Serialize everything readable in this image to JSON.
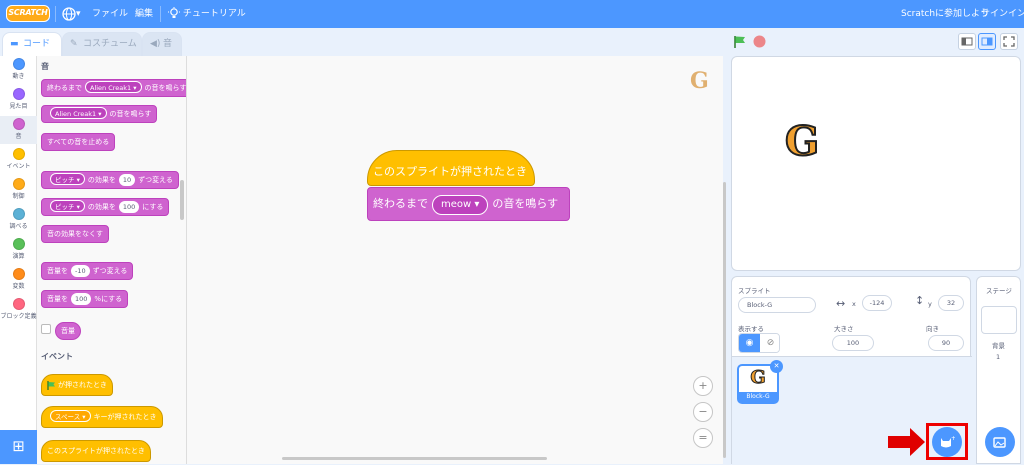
{
  "menubar": {
    "logo": "SCRATCH",
    "globe_caret": "▾",
    "file": "ファイル",
    "edit": "編集",
    "tutorials": "チュートリアル",
    "join": "Scratchに参加しよう",
    "signin": "サインイン"
  },
  "tabs": {
    "code": "コード",
    "costumes": "コスチューム",
    "sounds": "音"
  },
  "categories": [
    {
      "label": "動き",
      "color": "#4c97ff"
    },
    {
      "label": "見た目",
      "color": "#9966ff"
    },
    {
      "label": "音",
      "color": "#cf63cf"
    },
    {
      "label": "イベント",
      "color": "#ffbf00"
    },
    {
      "label": "制御",
      "color": "#ffab19"
    },
    {
      "label": "調べる",
      "color": "#5cb1d6"
    },
    {
      "label": "演算",
      "color": "#59c059"
    },
    {
      "label": "変数",
      "color": "#ff8c1a"
    },
    {
      "label": "ブロック定義",
      "color": "#ff6680"
    }
  ],
  "palette": {
    "sound_title": "音",
    "play_until_done": {
      "pre": "終わるまで",
      "value": "Alien Creak1 ▾",
      "post": "の音を鳴らす"
    },
    "start_sound": {
      "value": "Alien Creak1 ▾",
      "post": "の音を鳴らす"
    },
    "stop_all": "すべての音を止める",
    "change_effect": {
      "value": "ピッチ ▾",
      "mid": "の効果を",
      "num": "10",
      "post": "ずつ変える"
    },
    "set_effect": {
      "value": "ピッチ ▾",
      "mid": "の効果を",
      "num": "100",
      "post": "にする"
    },
    "clear_effects": "音の効果をなくす",
    "change_volume": {
      "pre": "音量を",
      "num": "-10",
      "post": "ずつ変える"
    },
    "set_volume": {
      "pre": "音量を",
      "num": "100",
      "post": "%にする"
    },
    "volume_reporter": "音量",
    "events_title": "イベント",
    "flag_clicked": "が押されたとき",
    "key_pressed": {
      "value": "スペース ▾",
      "post": "キーが押されたとき"
    },
    "sprite_clicked": "このスプライトが押されたとき"
  },
  "workspace": {
    "hat": "このスプライトが押されたとき",
    "play": {
      "pre": "終わるまで",
      "value": "meow ▾",
      "post": "の音を鳴らす"
    },
    "sprite_thumb": "G",
    "zoom_in": "+",
    "zoom_out": "−",
    "zoom_reset": "="
  },
  "stage": {
    "sprite_letter": "G"
  },
  "sprite_info": {
    "title": "スプライト",
    "name": "Block-G",
    "x_label": "x",
    "x": "-124",
    "y_label": "y",
    "y": "32",
    "show_label": "表示する",
    "size_label": "大きさ",
    "size": "100",
    "direction_label": "向き",
    "direction": "90"
  },
  "sprite_list": [
    {
      "name": "Block-G",
      "letter": "G"
    }
  ],
  "stage_panel": {
    "title": "ステージ",
    "backdrops_label": "背景",
    "backdrops_count": "1"
  },
  "colors": {
    "accent": "#4c97ff",
    "sound": "#cf63cf",
    "events": "#ffbf00",
    "highlight": "#e00000"
  }
}
